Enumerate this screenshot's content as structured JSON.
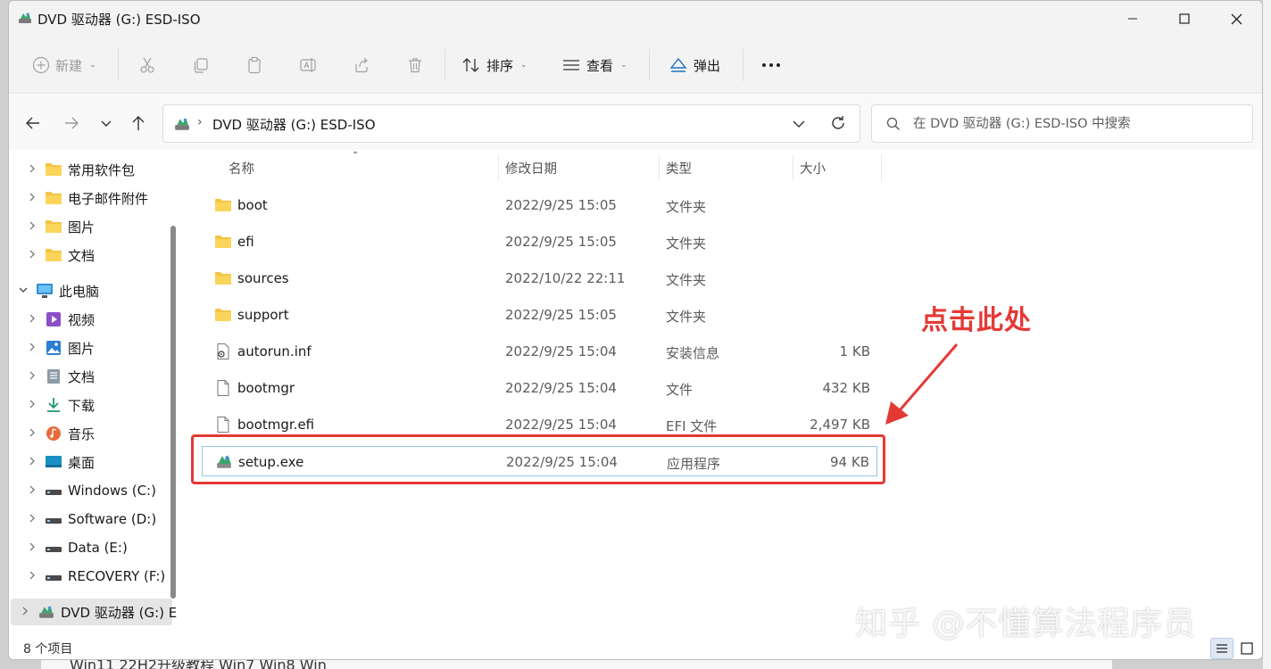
{
  "window": {
    "title": "DVD 驱动器 (G:) ESD-ISO"
  },
  "toolbar": {
    "new_label": "新建",
    "sort_label": "排序",
    "view_label": "查看",
    "eject_label": "弹出"
  },
  "address": {
    "path": "DVD 驱动器 (G:) ESD-ISO",
    "search_placeholder": "在 DVD 驱动器 (G:) ESD-ISO 中搜索"
  },
  "nav": {
    "items": [
      {
        "label": "常用软件包",
        "icon": "folder-icon"
      },
      {
        "label": "电子邮件附件",
        "icon": "folder-icon"
      },
      {
        "label": "图片",
        "icon": "folder-icon"
      },
      {
        "label": "文档",
        "icon": "folder-icon"
      },
      {
        "label": "此电脑",
        "icon": "computer-icon"
      },
      {
        "label": "视频",
        "icon": "video-icon"
      },
      {
        "label": "图片",
        "icon": "pictures-icon"
      },
      {
        "label": "文档",
        "icon": "documents-icon"
      },
      {
        "label": "下载",
        "icon": "download-icon"
      },
      {
        "label": "音乐",
        "icon": "music-icon"
      },
      {
        "label": "桌面",
        "icon": "desktop-icon"
      },
      {
        "label": "Windows (C:)",
        "icon": "drive-icon"
      },
      {
        "label": "Software (D:)",
        "icon": "drive-icon"
      },
      {
        "label": "Data (E:)",
        "icon": "drive-icon"
      },
      {
        "label": "RECOVERY (F:)",
        "icon": "drive-icon"
      },
      {
        "label": "DVD 驱动器 (G:) E",
        "icon": "dvd-drive-icon"
      }
    ]
  },
  "columns": {
    "name": "名称",
    "date": "修改日期",
    "type": "类型",
    "size": "大小"
  },
  "files": [
    {
      "name": "boot",
      "date": "2022/9/25 15:05",
      "type": "文件夹",
      "size": "",
      "icon": "folder-icon"
    },
    {
      "name": "efi",
      "date": "2022/9/25 15:05",
      "type": "文件夹",
      "size": "",
      "icon": "folder-icon"
    },
    {
      "name": "sources",
      "date": "2022/10/22 22:11",
      "type": "文件夹",
      "size": "",
      "icon": "folder-icon"
    },
    {
      "name": "support",
      "date": "2022/9/25 15:05",
      "type": "文件夹",
      "size": "",
      "icon": "folder-icon"
    },
    {
      "name": "autorun.inf",
      "date": "2022/9/25 15:04",
      "type": "安装信息",
      "size": "1 KB",
      "icon": "settings-file-icon"
    },
    {
      "name": "bootmgr",
      "date": "2022/9/25 15:04",
      "type": "文件",
      "size": "432 KB",
      "icon": "file-icon"
    },
    {
      "name": "bootmgr.efi",
      "date": "2022/9/25 15:04",
      "type": "EFI 文件",
      "size": "2,497 KB",
      "icon": "file-icon"
    },
    {
      "name": "setup.exe",
      "date": "2022/9/25 15:04",
      "type": "应用程序",
      "size": "94 KB",
      "icon": "setup-icon"
    }
  ],
  "status": {
    "count": "8 个项目"
  },
  "annotation": {
    "text": "点击此处"
  },
  "watermark": "知乎 @不懂算法程序员",
  "background": {
    "text": "Win11 22H2升级教程 Win7 Win8 Win"
  },
  "colors": {
    "annotation": "#e53935",
    "folder": "#f6c443",
    "selection_border": "#99c3e8"
  }
}
